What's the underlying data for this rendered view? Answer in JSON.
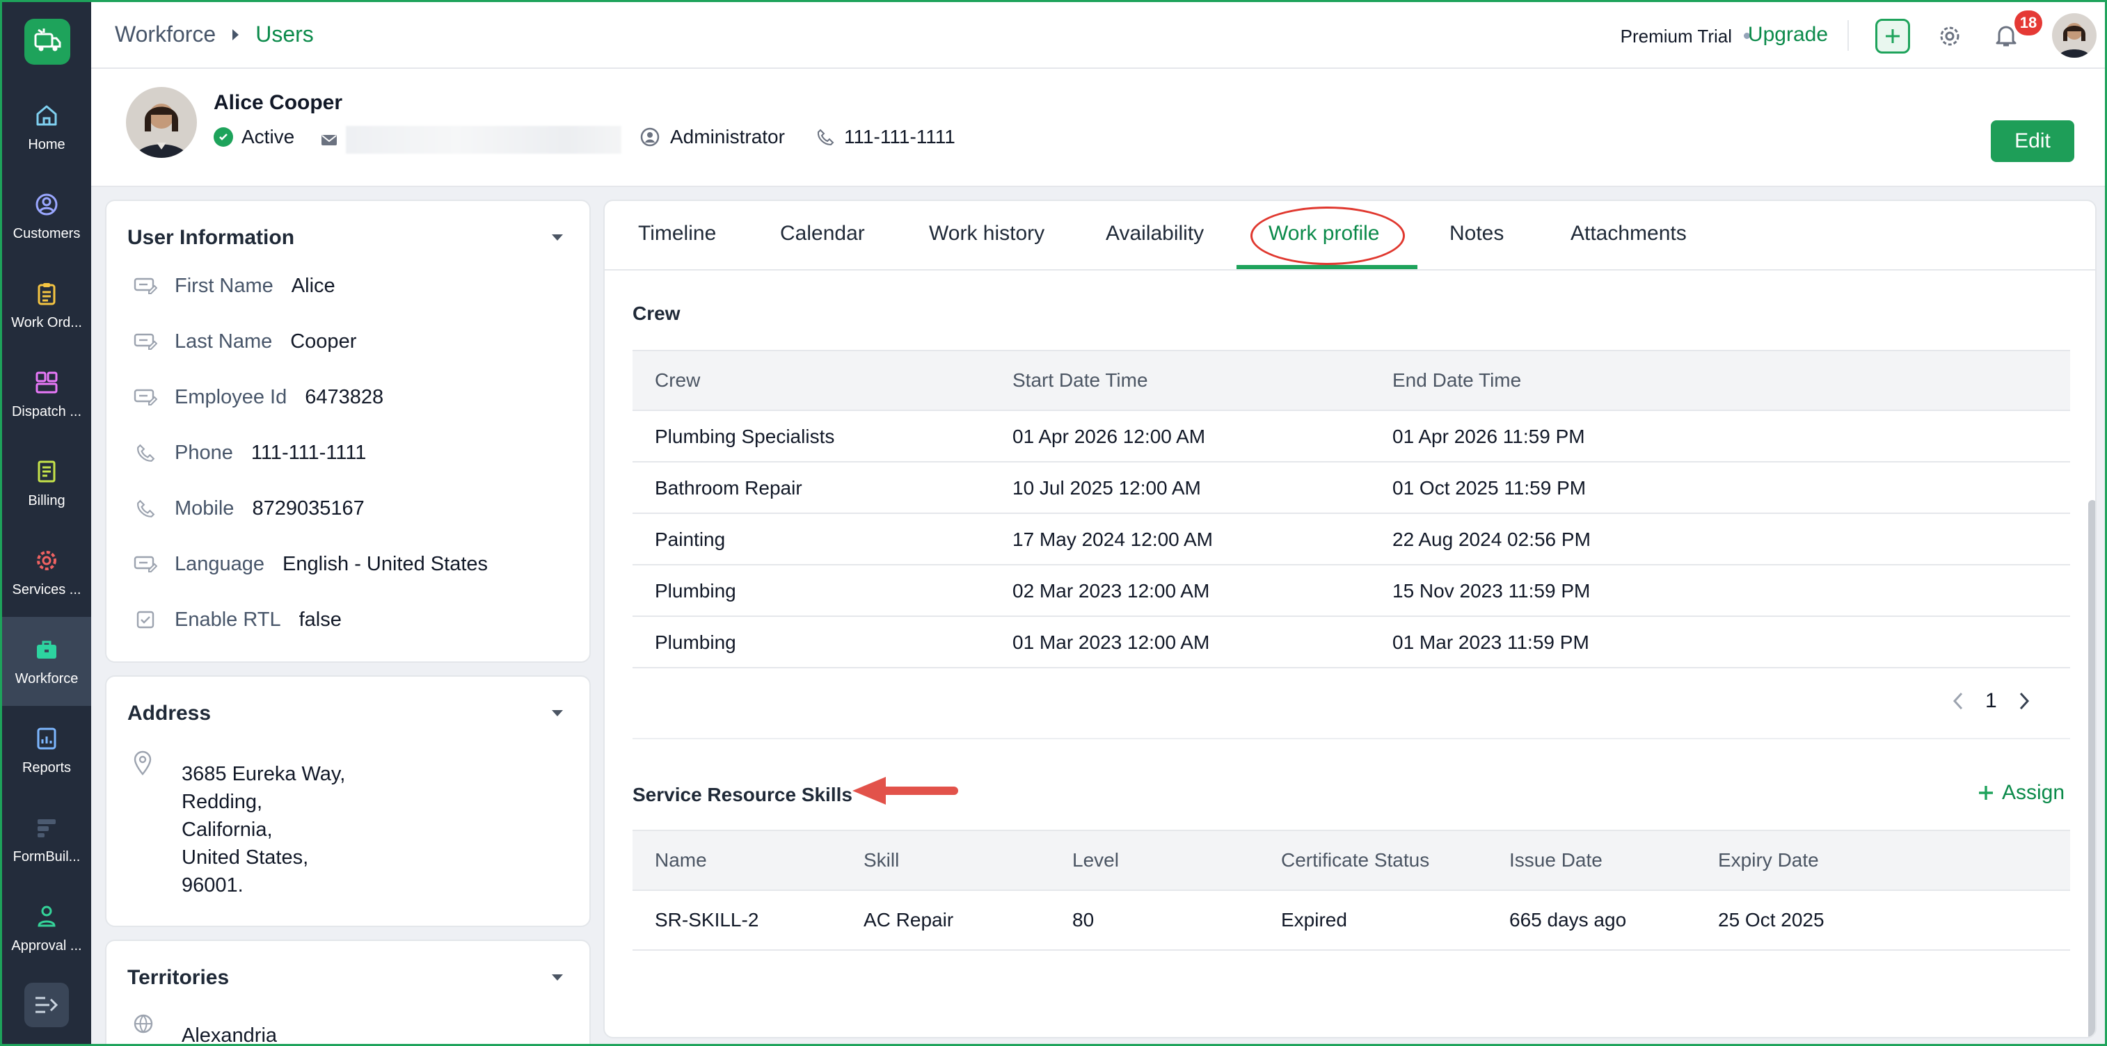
{
  "breadcrumb": {
    "section": "Workforce",
    "page": "Users"
  },
  "topbar": {
    "trial_label": "Premium Trial",
    "upgrade_label": "Upgrade",
    "notification_count": "18"
  },
  "rail": {
    "items": [
      {
        "label": "Home",
        "icon": "home-icon"
      },
      {
        "label": "Customers",
        "icon": "customers-icon"
      },
      {
        "label": "Work Ord...",
        "icon": "clipboard-icon"
      },
      {
        "label": "Dispatch ...",
        "icon": "dispatch-grid-icon"
      },
      {
        "label": "Billing",
        "icon": "billing-icon"
      },
      {
        "label": "Services ...",
        "icon": "services-gear-icon"
      },
      {
        "label": "Workforce",
        "icon": "briefcase-icon"
      },
      {
        "label": "Reports",
        "icon": "reports-icon"
      },
      {
        "label": "FormBuil...",
        "icon": "formbuilder-icon"
      },
      {
        "label": "Approval ...",
        "icon": "approval-icon"
      }
    ]
  },
  "profile": {
    "name": "Alice Cooper",
    "status": "Active",
    "role": "Administrator",
    "phone": "111-111-1111",
    "edit_label": "Edit"
  },
  "user_info": {
    "title": "User Information",
    "fields": [
      {
        "label": "First Name",
        "value": "Alice"
      },
      {
        "label": "Last Name",
        "value": "Cooper"
      },
      {
        "label": "Employee Id",
        "value": "6473828"
      },
      {
        "label": "Phone",
        "value": "111-111-1111"
      },
      {
        "label": "Mobile",
        "value": "8729035167"
      },
      {
        "label": "Language",
        "value": "English - United States"
      },
      {
        "label": "Enable RTL",
        "value": "false"
      }
    ]
  },
  "address": {
    "title": "Address",
    "lines": [
      "3685 Eureka Way,",
      "Redding,",
      "California,",
      "United States,",
      "96001."
    ]
  },
  "territories": {
    "title": "Territories",
    "first_item": "Alexandria"
  },
  "tabs": [
    "Timeline",
    "Calendar",
    "Work history",
    "Availability",
    "Work profile",
    "Notes",
    "Attachments"
  ],
  "active_tab": "Work profile",
  "crew": {
    "title": "Crew",
    "columns": [
      "Crew",
      "Start Date Time",
      "End Date Time"
    ],
    "rows": [
      [
        "Plumbing Specialists",
        "01 Apr 2026 12:00 AM",
        "01 Apr 2026 11:59 PM"
      ],
      [
        "Bathroom Repair",
        "10 Jul 2025 12:00 AM",
        "01 Oct 2025 11:59 PM"
      ],
      [
        "Painting",
        "17 May 2024 12:00 AM",
        "22 Aug 2024 02:56 PM"
      ],
      [
        "Plumbing",
        "02 Mar 2023 12:00 AM",
        "15 Nov 2023 11:59 PM"
      ],
      [
        "Plumbing",
        "01 Mar 2023 12:00 AM",
        "01 Mar 2023 11:59 PM"
      ]
    ],
    "page": "1"
  },
  "skills": {
    "title": "Service Resource Skills",
    "assign_label": "Assign",
    "columns": [
      "Name",
      "Skill",
      "Level",
      "Certificate Status",
      "Issue Date",
      "Expiry Date"
    ],
    "rows": [
      [
        "SR-SKILL-2",
        "AC Repair",
        "80",
        "Expired",
        "665 days ago",
        "25 Oct 2025"
      ]
    ]
  },
  "colors": {
    "brand_green": "#1ea35b",
    "rail_bg": "#232c3b",
    "annotation_red": "#e0382f"
  }
}
